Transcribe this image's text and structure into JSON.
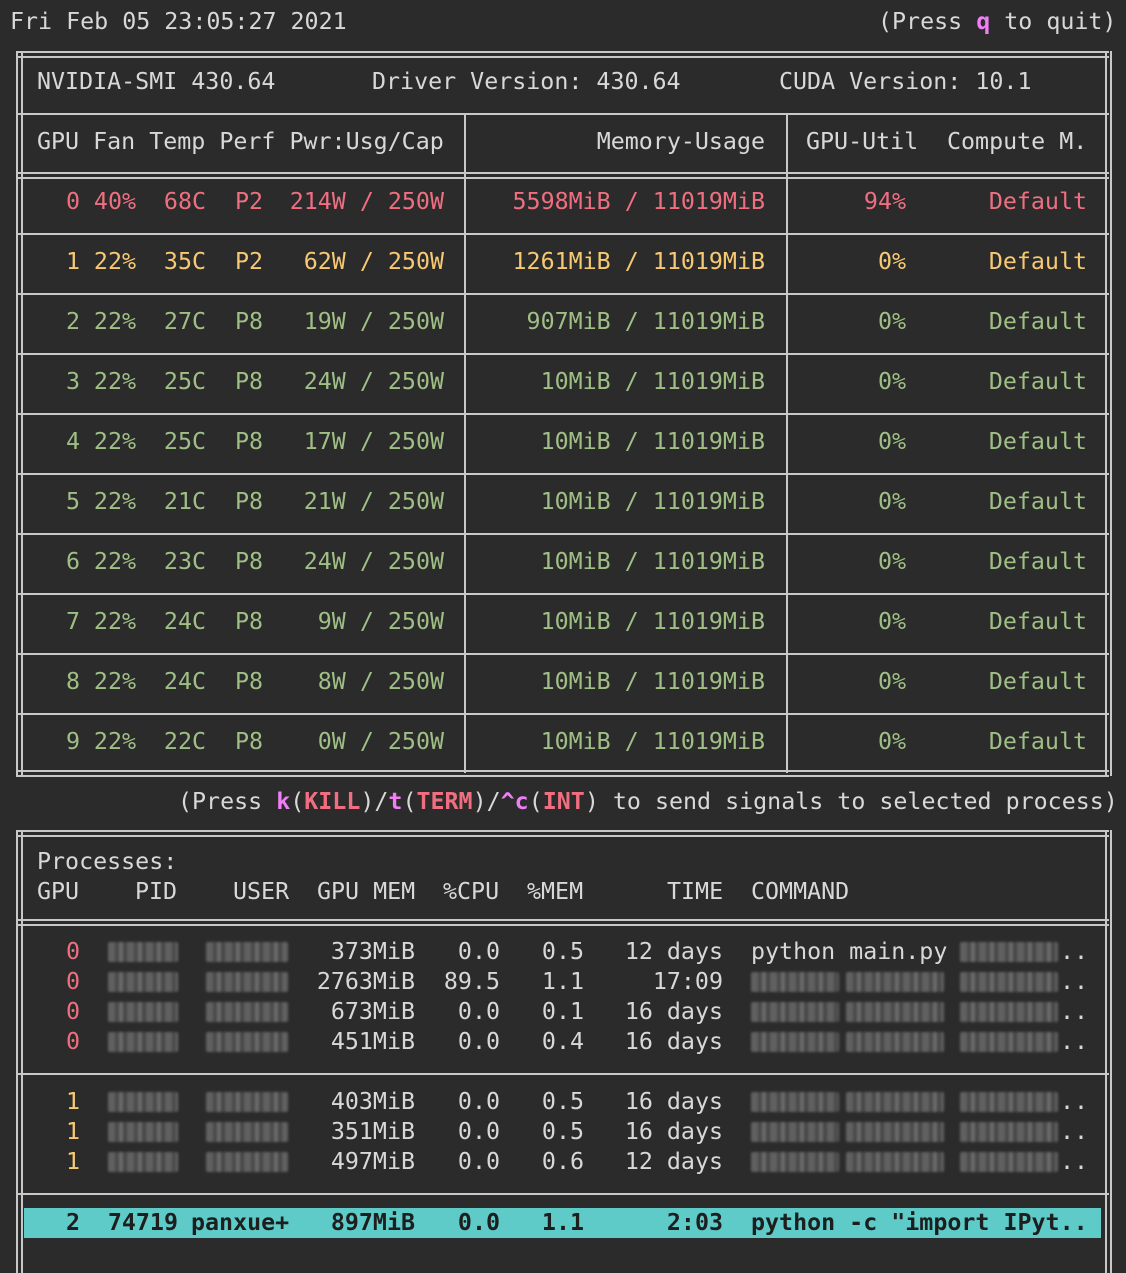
{
  "topbar": {
    "datetime": "Fri Feb 05 23:05:27 2021",
    "quit_pre": "(Press ",
    "quit_key": "q",
    "quit_post": " to quit)"
  },
  "header": {
    "smi": "NVIDIA-SMI 430.64",
    "driver": "Driver Version: 430.64",
    "cuda": "CUDA Version: 10.1"
  },
  "columns": {
    "left": "GPU Fan Temp Perf Pwr:Usg/Cap",
    "mem": "Memory-Usage",
    "util": "GPU-Util",
    "compute": "Compute M."
  },
  "gpus": [
    {
      "idx": "0",
      "fan": "40%",
      "temp": "68C",
      "perf": "P2",
      "pwr": "214W / 250W",
      "mem": "5598MiB / 11019MiB",
      "util": "94%",
      "mode": "Default",
      "color": "#ef6f81"
    },
    {
      "idx": "1",
      "fan": "22%",
      "temp": "35C",
      "perf": "P2",
      "pwr": "62W / 250W",
      "mem": "1261MiB / 11019MiB",
      "util": "0%",
      "mode": "Default",
      "color": "#f7c972"
    },
    {
      "idx": "2",
      "fan": "22%",
      "temp": "27C",
      "perf": "P8",
      "pwr": "19W / 250W",
      "mem": "907MiB / 11019MiB",
      "util": "0%",
      "mode": "Default",
      "color": "#9fbf85"
    },
    {
      "idx": "3",
      "fan": "22%",
      "temp": "25C",
      "perf": "P8",
      "pwr": "24W / 250W",
      "mem": "10MiB / 11019MiB",
      "util": "0%",
      "mode": "Default",
      "color": "#9fbf85"
    },
    {
      "idx": "4",
      "fan": "22%",
      "temp": "25C",
      "perf": "P8",
      "pwr": "17W / 250W",
      "mem": "10MiB / 11019MiB",
      "util": "0%",
      "mode": "Default",
      "color": "#9fbf85"
    },
    {
      "idx": "5",
      "fan": "22%",
      "temp": "21C",
      "perf": "P8",
      "pwr": "21W / 250W",
      "mem": "10MiB / 11019MiB",
      "util": "0%",
      "mode": "Default",
      "color": "#9fbf85"
    },
    {
      "idx": "6",
      "fan": "22%",
      "temp": "23C",
      "perf": "P8",
      "pwr": "24W / 250W",
      "mem": "10MiB / 11019MiB",
      "util": "0%",
      "mode": "Default",
      "color": "#9fbf85"
    },
    {
      "idx": "7",
      "fan": "22%",
      "temp": "24C",
      "perf": "P8",
      "pwr": "9W / 250W",
      "mem": "10MiB / 11019MiB",
      "util": "0%",
      "mode": "Default",
      "color": "#9fbf85"
    },
    {
      "idx": "8",
      "fan": "22%",
      "temp": "24C",
      "perf": "P8",
      "pwr": "8W / 250W",
      "mem": "10MiB / 11019MiB",
      "util": "0%",
      "mode": "Default",
      "color": "#9fbf85"
    },
    {
      "idx": "9",
      "fan": "22%",
      "temp": "22C",
      "perf": "P8",
      "pwr": "0W / 250W",
      "mem": "10MiB / 11019MiB",
      "util": "0%",
      "mode": "Default",
      "color": "#9fbf85"
    }
  ],
  "signal_hint": {
    "p1": "(Press ",
    "k": "k",
    "p2": "(",
    "kill": "KILL",
    "p3": ")/",
    "t": "t",
    "p4": "(",
    "term": "TERM",
    "p5": ")/",
    "c": "^c",
    "p6": "(",
    "int": "INT",
    "p7": ") to send signals to selected process)"
  },
  "processes": {
    "title": "Processes:",
    "headers": {
      "gpu": "GPU",
      "pid": "PID",
      "user": "USER",
      "gpu_mem": "GPU MEM",
      "cpu": "%CPU",
      "mem": "%MEM",
      "time": "TIME",
      "command": "COMMAND"
    },
    "groups": [
      {
        "color": "#ef6f81",
        "rows": [
          {
            "gpu": "0",
            "gpu_mem": "373MiB",
            "cpu": "0.0",
            "mem": "0.5",
            "time": "12 days",
            "command": "python main.py",
            "tail": ".."
          },
          {
            "gpu": "0",
            "gpu_mem": "2763MiB",
            "cpu": "89.5",
            "mem": "1.1",
            "time": "17:09",
            "command": "",
            "tail": ".."
          },
          {
            "gpu": "0",
            "gpu_mem": "673MiB",
            "cpu": "0.0",
            "mem": "0.1",
            "time": "16 days",
            "command": "",
            "tail": ".."
          },
          {
            "gpu": "0",
            "gpu_mem": "451MiB",
            "cpu": "0.0",
            "mem": "0.4",
            "time": "16 days",
            "command": "",
            "tail": ".."
          }
        ]
      },
      {
        "color": "#f7c972",
        "rows": [
          {
            "gpu": "1",
            "gpu_mem": "403MiB",
            "cpu": "0.0",
            "mem": "0.5",
            "time": "16 days",
            "command": "",
            "tail": ".."
          },
          {
            "gpu": "1",
            "gpu_mem": "351MiB",
            "cpu": "0.0",
            "mem": "0.5",
            "time": "16 days",
            "command": "",
            "tail": ".."
          },
          {
            "gpu": "1",
            "gpu_mem": "497MiB",
            "cpu": "0.0",
            "mem": "0.6",
            "time": "12 days",
            "command": "",
            "tail": ".."
          }
        ]
      }
    ],
    "selected": {
      "gpu": "2",
      "pid": "74719",
      "user": "panxue+",
      "gpu_mem": "897MiB",
      "cpu": "0.0",
      "mem": "1.1",
      "time": "2:03",
      "command": "python -c \"import IPyt.."
    },
    "selection_color": "#5ecbc8"
  }
}
